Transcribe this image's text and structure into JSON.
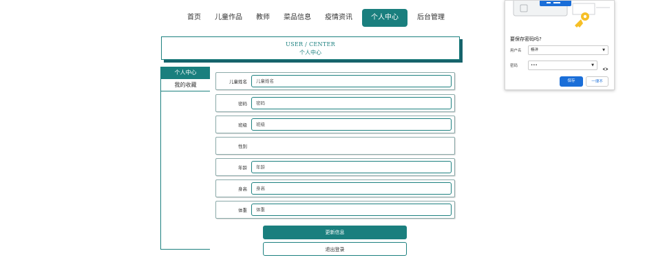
{
  "nav": {
    "items": [
      {
        "label": "首页"
      },
      {
        "label": "儿童作品"
      },
      {
        "label": "教师"
      },
      {
        "label": "菜品信息"
      },
      {
        "label": "疫情资讯"
      },
      {
        "label": "个人中心",
        "active": true
      },
      {
        "label": "后台管理"
      }
    ]
  },
  "header": {
    "title_en": "USER / CENTER",
    "title_cn": "个人中心"
  },
  "sidebar": {
    "items": [
      {
        "label": "个人中心",
        "active": true
      },
      {
        "label": "我的收藏"
      }
    ]
  },
  "form": {
    "fields": [
      {
        "label": "儿童姓名",
        "placeholder": "儿童姓名"
      },
      {
        "label": "密码",
        "placeholder": "密码"
      },
      {
        "label": "班级",
        "placeholder": "班级"
      },
      {
        "label": "性别",
        "placeholder": ""
      },
      {
        "label": "年龄",
        "placeholder": "年龄"
      },
      {
        "label": "身高",
        "placeholder": "身高"
      },
      {
        "label": "体重",
        "placeholder": "体重"
      }
    ],
    "update_label": "更新信息",
    "logout_label": "退出登录"
  },
  "password_popup": {
    "title": "要保存密码吗?",
    "username_label": "用户名",
    "username_value": "杨洋",
    "password_label": "密码",
    "password_value": "•••",
    "save_label": "保存",
    "never_label": "一律不"
  },
  "colors": {
    "accent": "#1a7f7e",
    "popup_blue": "#1a6ed8"
  }
}
